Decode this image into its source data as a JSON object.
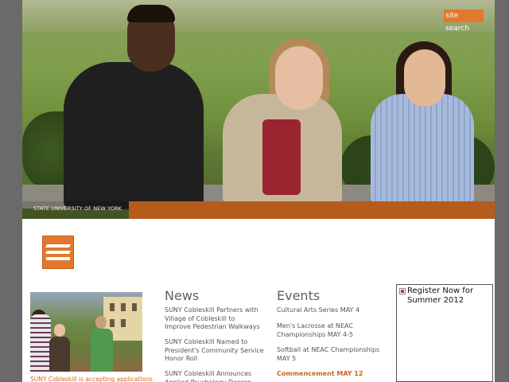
{
  "header": {
    "site_search_label": "site search",
    "university_label": "STATE UNIVERSITY OF NEW YORK"
  },
  "thumb": {
    "caption": "SUNY Cobleskill is accepting applications"
  },
  "news": {
    "title": "News",
    "items": [
      "SUNY Cobleskill Partners with Village of Cobleskill to Improve Pedestrian Walkways",
      "SUNY Cobleskill Named to President's Community Service Honor Roll",
      "SUNY Cobleskill Announces Applied Psychology Degree"
    ]
  },
  "events": {
    "title": "Events",
    "items": [
      "Cultural Arts Series MAY 4",
      "Men's Lacrosse at NEAC Championships MAY 4-5",
      "Softball at NEAC Championships MAY 5",
      "Commencement MAY 12"
    ]
  },
  "register": {
    "text": "Register Now for Summer 2012"
  },
  "colors": {
    "accent": "#e0792d",
    "band": "#b55c1c",
    "background": "#6a6a6a"
  }
}
